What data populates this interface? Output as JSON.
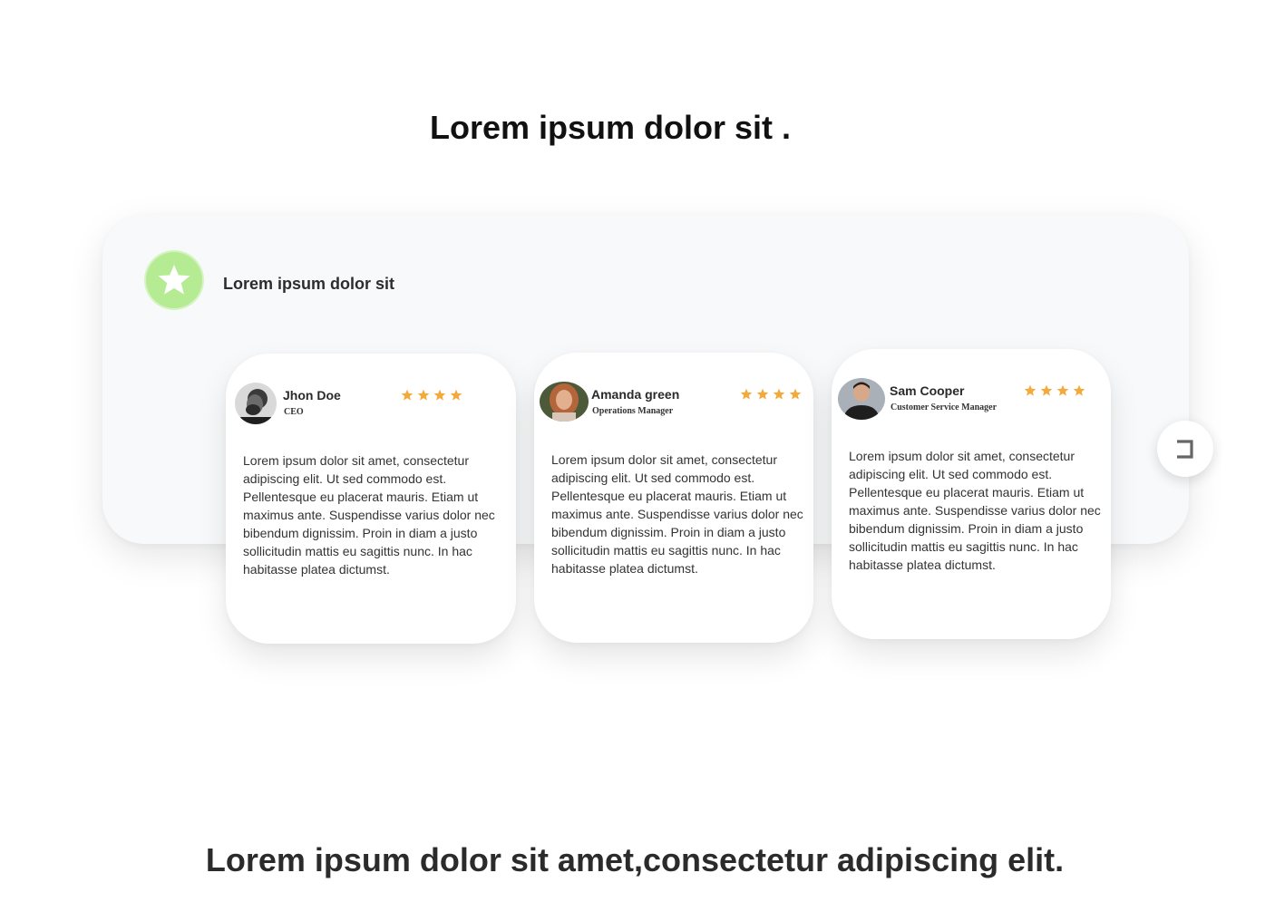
{
  "headings": {
    "top": "Lorem ipsum dolor sit .",
    "bottom": "Lorem ipsum dolor sit amet,consectetur adipiscing elit."
  },
  "panel": {
    "title": "Lorem ipsum dolor sit",
    "badge_icon": "star-icon",
    "badge_color": "#b5ec93"
  },
  "star_color": "#f4a93b",
  "testimonials": [
    {
      "name": "Jhon Doe",
      "role": "CEO",
      "rating": 4,
      "text": "Lorem ipsum dolor sit amet, consectetur adipiscing elit. Ut sed commodo est. Pellentesque eu placerat mauris. Etiam ut maximus ante. Suspendisse varius dolor nec bibendum dignissim. Proin in diam a justo sollicitudin mattis eu sagittis nunc. In hac habitasse platea dictumst."
    },
    {
      "name": "Amanda green",
      "role": "Operations Manager",
      "rating": 4,
      "text": "Lorem ipsum dolor sit amet, consectetur adipiscing elit. Ut sed commodo est. Pellentesque eu placerat mauris. Etiam ut maximus ante. Suspendisse varius dolor nec bibendum dignissim. Proin in diam a justo sollicitudin mattis eu sagittis nunc. In hac habitasse platea dictumst."
    },
    {
      "name": "Sam Cooper",
      "role": "Customer Service Manager",
      "rating": 4,
      "text": "Lorem ipsum dolor sit amet, consectetur adipiscing elit. Ut sed commodo est. Pellentesque eu placerat mauris. Etiam ut maximus ante. Suspendisse varius dolor nec bibendum dignissim. Proin in diam a justo sollicitudin mattis eu sagittis nunc. In hac habitasse platea dictumst."
    }
  ],
  "next_button": {
    "icon": "chevron-right-icon"
  }
}
